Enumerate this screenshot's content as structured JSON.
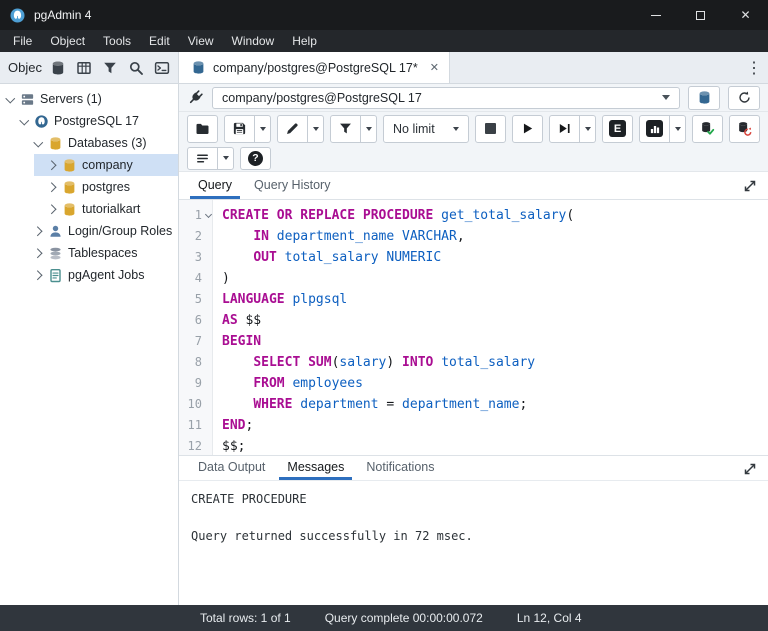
{
  "colors": {
    "accent": "#2e6fbe",
    "brand_blue": "#336791",
    "db_amber": "#d9a62e",
    "selection": "#cfe0f5",
    "keyword": "#a90d92",
    "identifier": "#0d5fc0",
    "titlebar": "#191b1d",
    "menubar": "#24272b",
    "statusbar": "#30363d"
  },
  "window": {
    "title": "pgAdmin 4"
  },
  "icons": {
    "close": "✕",
    "kebab": "⋮",
    "help": "?"
  },
  "menu": {
    "items": [
      "File",
      "Object",
      "Tools",
      "Edit",
      "View",
      "Window",
      "Help"
    ]
  },
  "explorer": {
    "title": "Objec"
  },
  "tabbar": {
    "active_tab": "company/postgres@PostgreSQL 17*"
  },
  "sidebar": {
    "items": [
      {
        "label": "Servers (1)",
        "depth": 0,
        "caret": "down",
        "icon": "server",
        "selected": false
      },
      {
        "label": "PostgreSQL 17",
        "depth": 1,
        "caret": "down",
        "icon": "postgres",
        "selected": false
      },
      {
        "label": "Databases (3)",
        "depth": 2,
        "caret": "down",
        "icon": "databases",
        "selected": false
      },
      {
        "label": "company",
        "depth": 3,
        "caret": "right",
        "icon": "database",
        "selected": true
      },
      {
        "label": "postgres",
        "depth": 3,
        "caret": "right",
        "icon": "database",
        "selected": false
      },
      {
        "label": "tutorialkart",
        "depth": 3,
        "caret": "right",
        "icon": "database",
        "selected": false
      },
      {
        "label": "Login/Group Roles",
        "depth": 2,
        "caret": "right",
        "icon": "roles",
        "selected": false
      },
      {
        "label": "Tablespaces",
        "depth": 2,
        "caret": "right",
        "icon": "tablespaces",
        "selected": false
      },
      {
        "label": "pgAgent Jobs",
        "depth": 2,
        "caret": "right",
        "icon": "jobs",
        "selected": false
      }
    ]
  },
  "querytool": {
    "connection": "company/postgres@PostgreSQL 17",
    "limit": "No limit",
    "explain_label": "E",
    "tabs": [
      "Query",
      "Query History"
    ]
  },
  "editor": {
    "lines": [
      [
        {
          "t": "k",
          "s": "CREATE OR REPLACE PROCEDURE"
        },
        {
          "t": "p",
          "s": " "
        },
        {
          "t": "i",
          "s": "get_total_salary"
        },
        {
          "t": "p",
          "s": "("
        }
      ],
      [
        {
          "t": "p",
          "s": "    "
        },
        {
          "t": "k",
          "s": "IN"
        },
        {
          "t": "p",
          "s": " "
        },
        {
          "t": "i",
          "s": "department_name"
        },
        {
          "t": "p",
          "s": " "
        },
        {
          "t": "i",
          "s": "VARCHAR"
        },
        {
          "t": "p",
          "s": ","
        }
      ],
      [
        {
          "t": "p",
          "s": "    "
        },
        {
          "t": "k",
          "s": "OUT"
        },
        {
          "t": "p",
          "s": " "
        },
        {
          "t": "i",
          "s": "total_salary"
        },
        {
          "t": "p",
          "s": " "
        },
        {
          "t": "i",
          "s": "NUMERIC"
        }
      ],
      [
        {
          "t": "p",
          "s": ")"
        }
      ],
      [
        {
          "t": "k",
          "s": "LANGUAGE"
        },
        {
          "t": "p",
          "s": " "
        },
        {
          "t": "i",
          "s": "plpgsql"
        }
      ],
      [
        {
          "t": "k",
          "s": "AS"
        },
        {
          "t": "p",
          "s": " $$"
        }
      ],
      [
        {
          "t": "k",
          "s": "BEGIN"
        }
      ],
      [
        {
          "t": "p",
          "s": "    "
        },
        {
          "t": "k",
          "s": "SELECT"
        },
        {
          "t": "p",
          "s": " "
        },
        {
          "t": "k",
          "s": "SUM"
        },
        {
          "t": "p",
          "s": "("
        },
        {
          "t": "i",
          "s": "salary"
        },
        {
          "t": "p",
          "s": ") "
        },
        {
          "t": "k",
          "s": "INTO"
        },
        {
          "t": "p",
          "s": " "
        },
        {
          "t": "i",
          "s": "total_salary"
        }
      ],
      [
        {
          "t": "p",
          "s": "    "
        },
        {
          "t": "k",
          "s": "FROM"
        },
        {
          "t": "p",
          "s": " "
        },
        {
          "t": "i",
          "s": "employees"
        }
      ],
      [
        {
          "t": "p",
          "s": "    "
        },
        {
          "t": "k",
          "s": "WHERE"
        },
        {
          "t": "p",
          "s": " "
        },
        {
          "t": "i",
          "s": "department"
        },
        {
          "t": "p",
          "s": " = "
        },
        {
          "t": "i",
          "s": "department_name"
        },
        {
          "t": "p",
          "s": ";"
        }
      ],
      [
        {
          "t": "k",
          "s": "END"
        },
        {
          "t": "p",
          "s": ";"
        }
      ],
      [
        {
          "t": "p",
          "s": "$$;"
        }
      ]
    ]
  },
  "output": {
    "tabs": [
      "Data Output",
      "Messages",
      "Notifications"
    ],
    "active_tab": "Messages",
    "messages": [
      "CREATE PROCEDURE",
      "",
      "Query returned successfully in 72 msec."
    ]
  },
  "statusbar": {
    "total_rows": "Total rows: 1 of 1",
    "query_complete": "Query complete 00:00:00.072",
    "cursor": "Ln 12, Col 4"
  }
}
